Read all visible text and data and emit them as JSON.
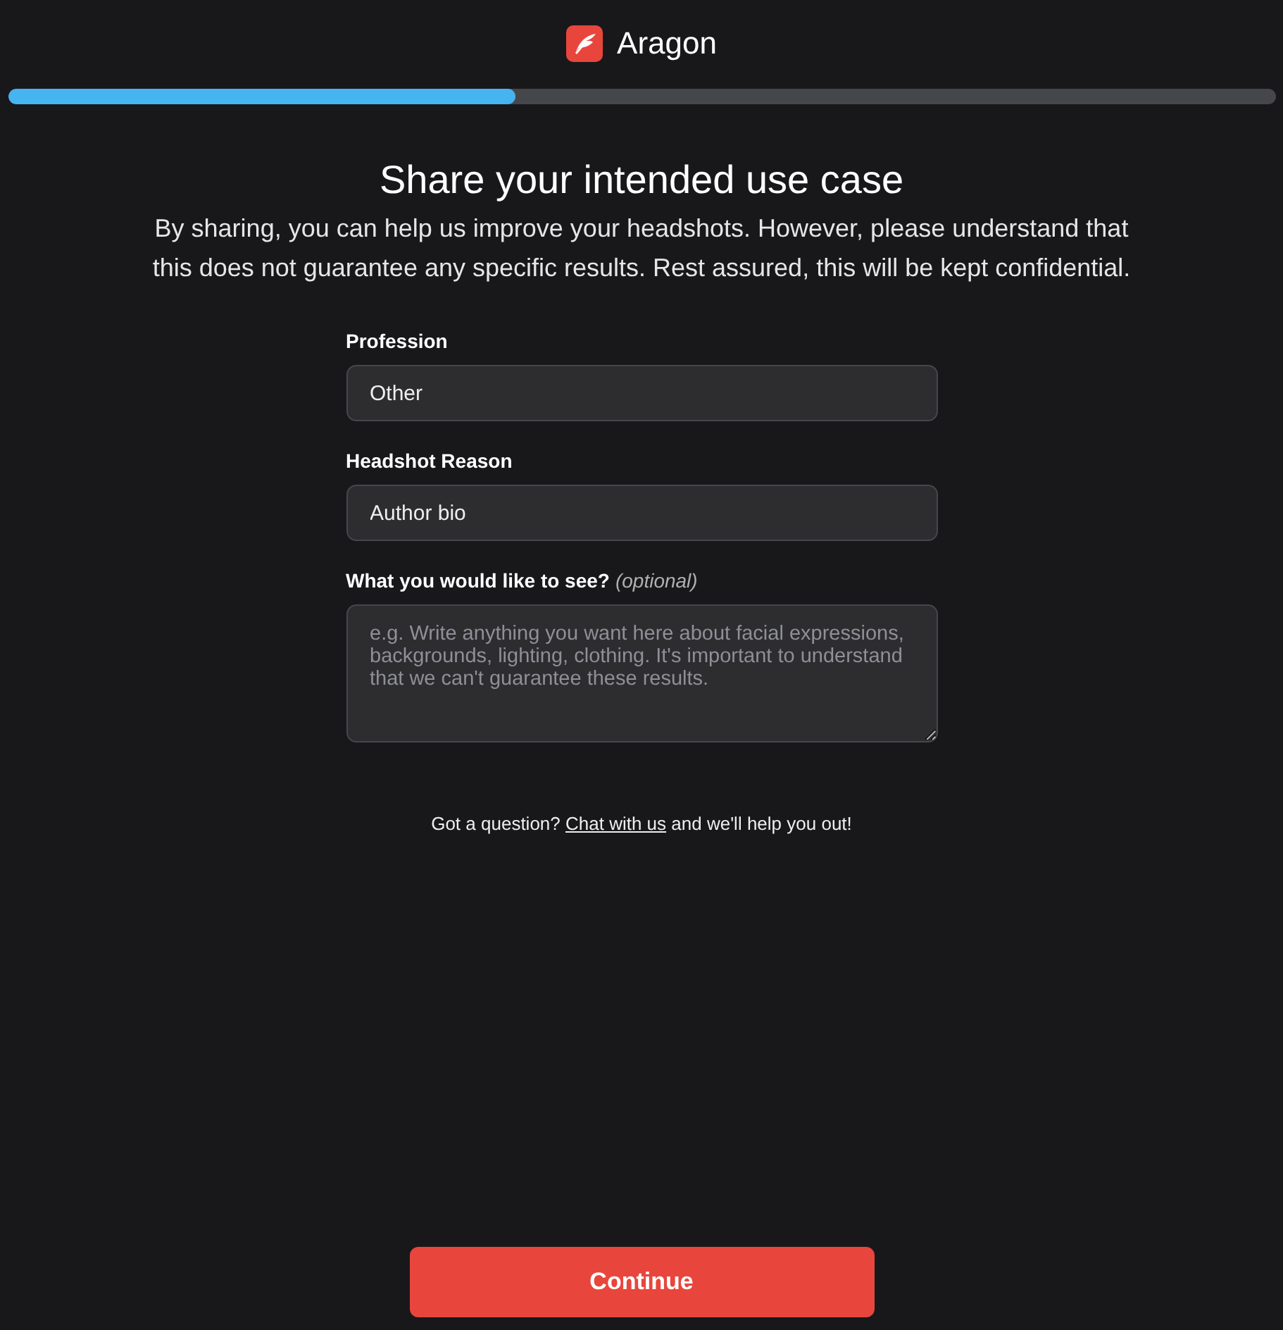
{
  "header": {
    "brand": "Aragon"
  },
  "progress": {
    "level": 0.4
  },
  "title": "Share your intended use case",
  "description": "By sharing, you can help us improve your headshots. However, please understand that this does not guarantee any specific results. Rest assured, this will be kept confidential.",
  "fields": [
    {
      "kind": "input",
      "label": "Profession",
      "value": "Other"
    },
    {
      "kind": "input",
      "label": "Headshot Reason",
      "value": "Author bio"
    },
    {
      "kind": "textarea",
      "label": "What you would like to see?",
      "note": "(optional)",
      "placeholder": "e.g. Write anything you want here about facial expressions, backgrounds, lighting, clothing. It's important to understand that we can't guarantee these results."
    }
  ],
  "help": {
    "before": "Got a question?",
    "link": "Chat with us",
    "after": "and we'll help you out!"
  },
  "buttons": [
    "Continue"
  ]
}
